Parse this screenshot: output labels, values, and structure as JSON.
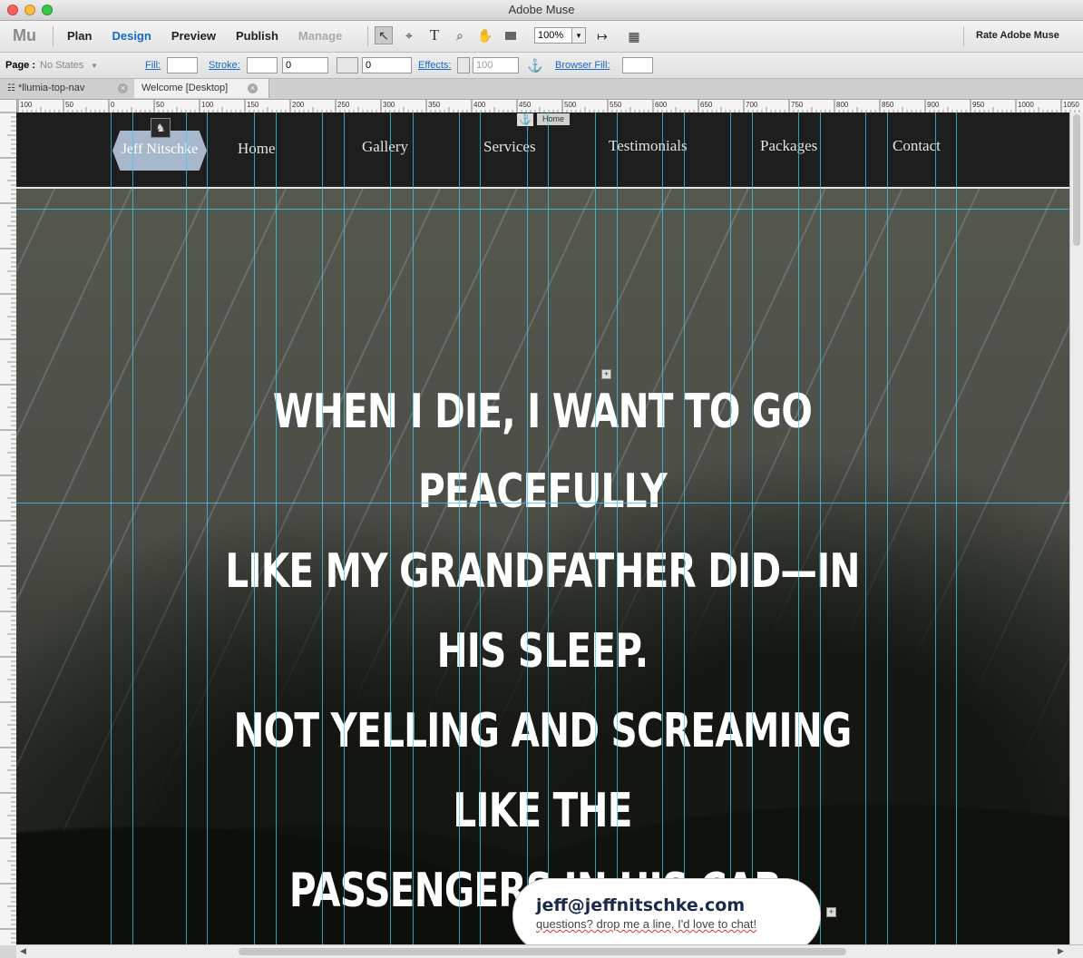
{
  "window": {
    "title": "Adobe Muse"
  },
  "toolbar": {
    "app_logo": "Mu",
    "modes": [
      "Plan",
      "Design",
      "Preview",
      "Publish",
      "Manage"
    ],
    "active_mode": "Design",
    "zoom": "100%",
    "rate_label": "Rate Adobe Muse"
  },
  "props": {
    "page_label": "Page :",
    "page_state": "No States",
    "fill_label": "Fill:",
    "stroke_label": "Stroke:",
    "stroke_value": "0",
    "corner_value": "0",
    "effects_label": "Effects:",
    "effects_value": "100",
    "browser_fill_label": "Browser Fill:"
  },
  "tabs": [
    {
      "label": "*llumia-top-nav"
    },
    {
      "label": "Welcome [Desktop]"
    }
  ],
  "ruler": {
    "h_ticks": [
      "100",
      "50",
      "0",
      "50",
      "100",
      "150",
      "200",
      "250",
      "300",
      "350",
      "400",
      "450",
      "500",
      "550",
      "600",
      "650",
      "700",
      "750",
      "800",
      "850",
      "900",
      "950",
      "1000",
      "1050"
    ]
  },
  "site": {
    "logo_text": "Jeff Nitschke",
    "nav": [
      "Home",
      "Gallery",
      "Services",
      "Testimonials",
      "Packages",
      "Contact"
    ],
    "anchor_label": "Home",
    "quote_lines": [
      "WHEN I DIE, I WANT TO GO PEACEFULLY",
      "LIKE MY GRANDFATHER DID—IN HIS SLEEP.",
      "NOT YELLING AND SCREAMING LIKE THE",
      "PASSENGERS IN HIS CAR."
    ],
    "email": "jeff@jeffnitschke.com",
    "email_sub": "questions? drop me a line, I'd love to chat!"
  }
}
